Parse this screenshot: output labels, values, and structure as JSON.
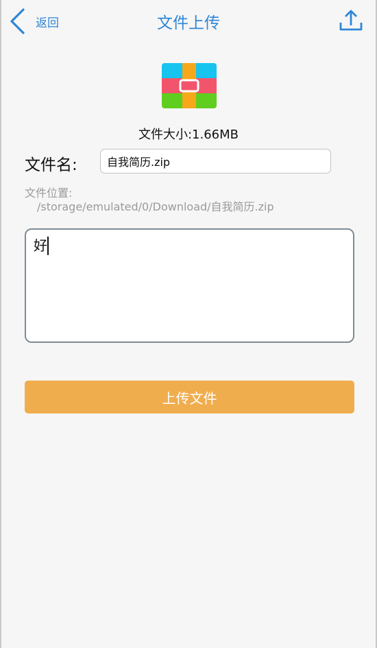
{
  "header": {
    "back_label": "返回",
    "title": "文件上传"
  },
  "file": {
    "size_text": "文件大小:1.66MB",
    "name_label": "文件名:",
    "name_value": "自我简历.zip",
    "location_label": "文件位置:",
    "location_path": "/storage/emulated/0/Download/自我简历.zip"
  },
  "description": {
    "value": "好"
  },
  "actions": {
    "upload_label": "上传文件"
  },
  "colors": {
    "accent": "#2f86d6",
    "button": "#f0ad4e"
  },
  "icons": {
    "back": "chevron-left-icon",
    "upload": "upload-icon",
    "file": "archive-file-icon"
  }
}
